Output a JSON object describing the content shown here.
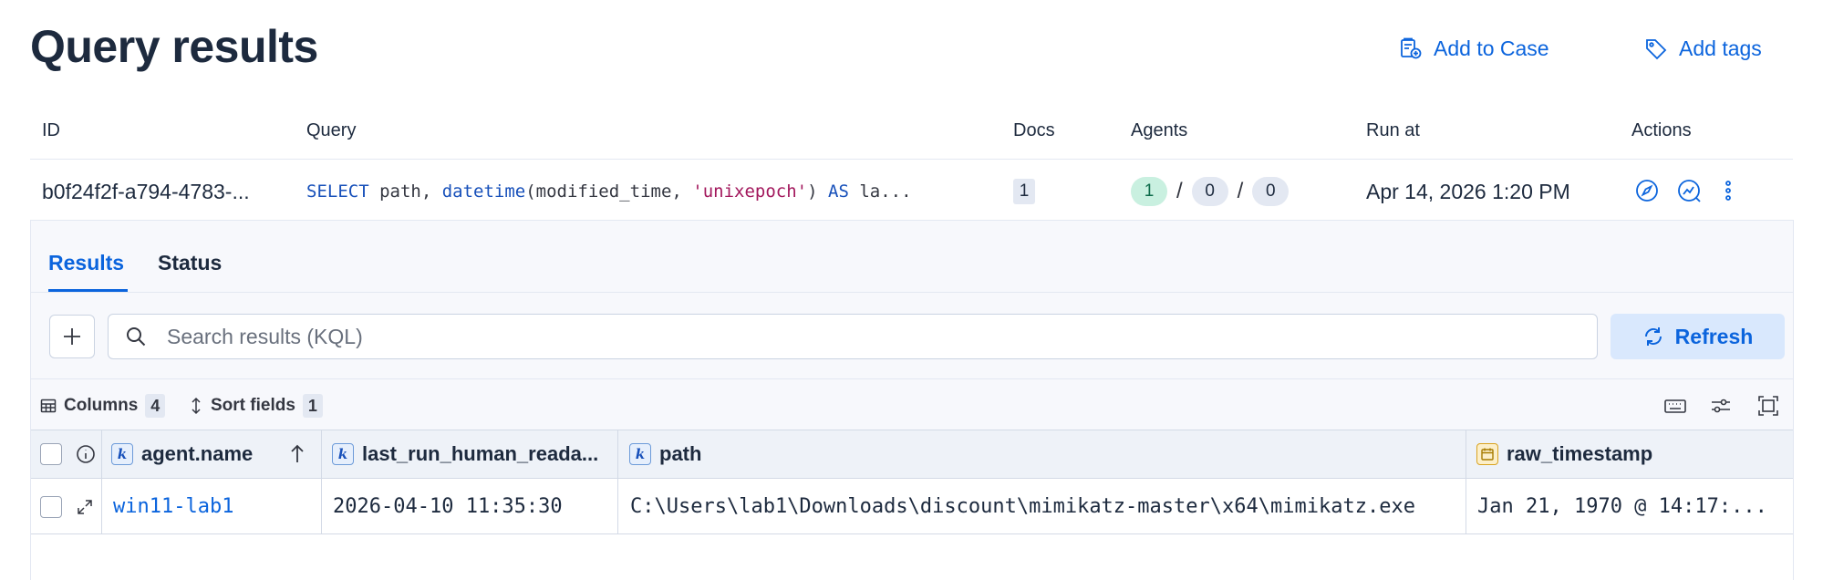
{
  "header": {
    "title": "Query results",
    "add_to_case": "Add to Case",
    "add_tags": "Add tags"
  },
  "queries_table": {
    "columns": [
      "ID",
      "Query",
      "Docs",
      "Agents",
      "Run at",
      "Actions"
    ],
    "row": {
      "id": "b0f24f2f-a794-4783-...",
      "query_tokens": {
        "kw1": "SELECT",
        "t1": " path, ",
        "fn1": "datetime",
        "t2": "(modified_time, ",
        "str1": "'unixepoch'",
        "t3": ") ",
        "kw2": "AS",
        "t4": " la..."
      },
      "docs": "1",
      "agents_success": "1",
      "agents_pending": "0",
      "agents_failed": "0",
      "agents_sep": "/",
      "run_at": "Apr 14, 2026 1:20 PM"
    }
  },
  "tabs": [
    {
      "label": "Results",
      "active": true
    },
    {
      "label": "Status",
      "active": false
    }
  ],
  "search": {
    "placeholder": "Search results (KQL)",
    "refresh_label": "Refresh"
  },
  "grid_toolbar": {
    "columns_label": "Columns",
    "columns_count": "4",
    "sort_label": "Sort fields",
    "sort_count": "1"
  },
  "grid": {
    "headers": {
      "agent_name": "agent.name",
      "last_run": "last_run_human_reada...",
      "path": "path",
      "raw_timestamp": "raw_timestamp"
    },
    "field_type_token": "k",
    "rows": [
      {
        "agent_name": "win11-lab1",
        "last_run": "2026-04-10 11:35:30",
        "path": "C:\\Users\\lab1\\Downloads\\discount\\mimikatz-master\\x64\\mimikatz.exe",
        "raw_timestamp": "Jan 21, 1970 @ 14:17:..."
      }
    ]
  },
  "colors": {
    "accent": "#0b64dd",
    "title": "#1d2a3e",
    "success_pill": "#c9f0e0",
    "panel_bg": "#f7f8fc"
  }
}
